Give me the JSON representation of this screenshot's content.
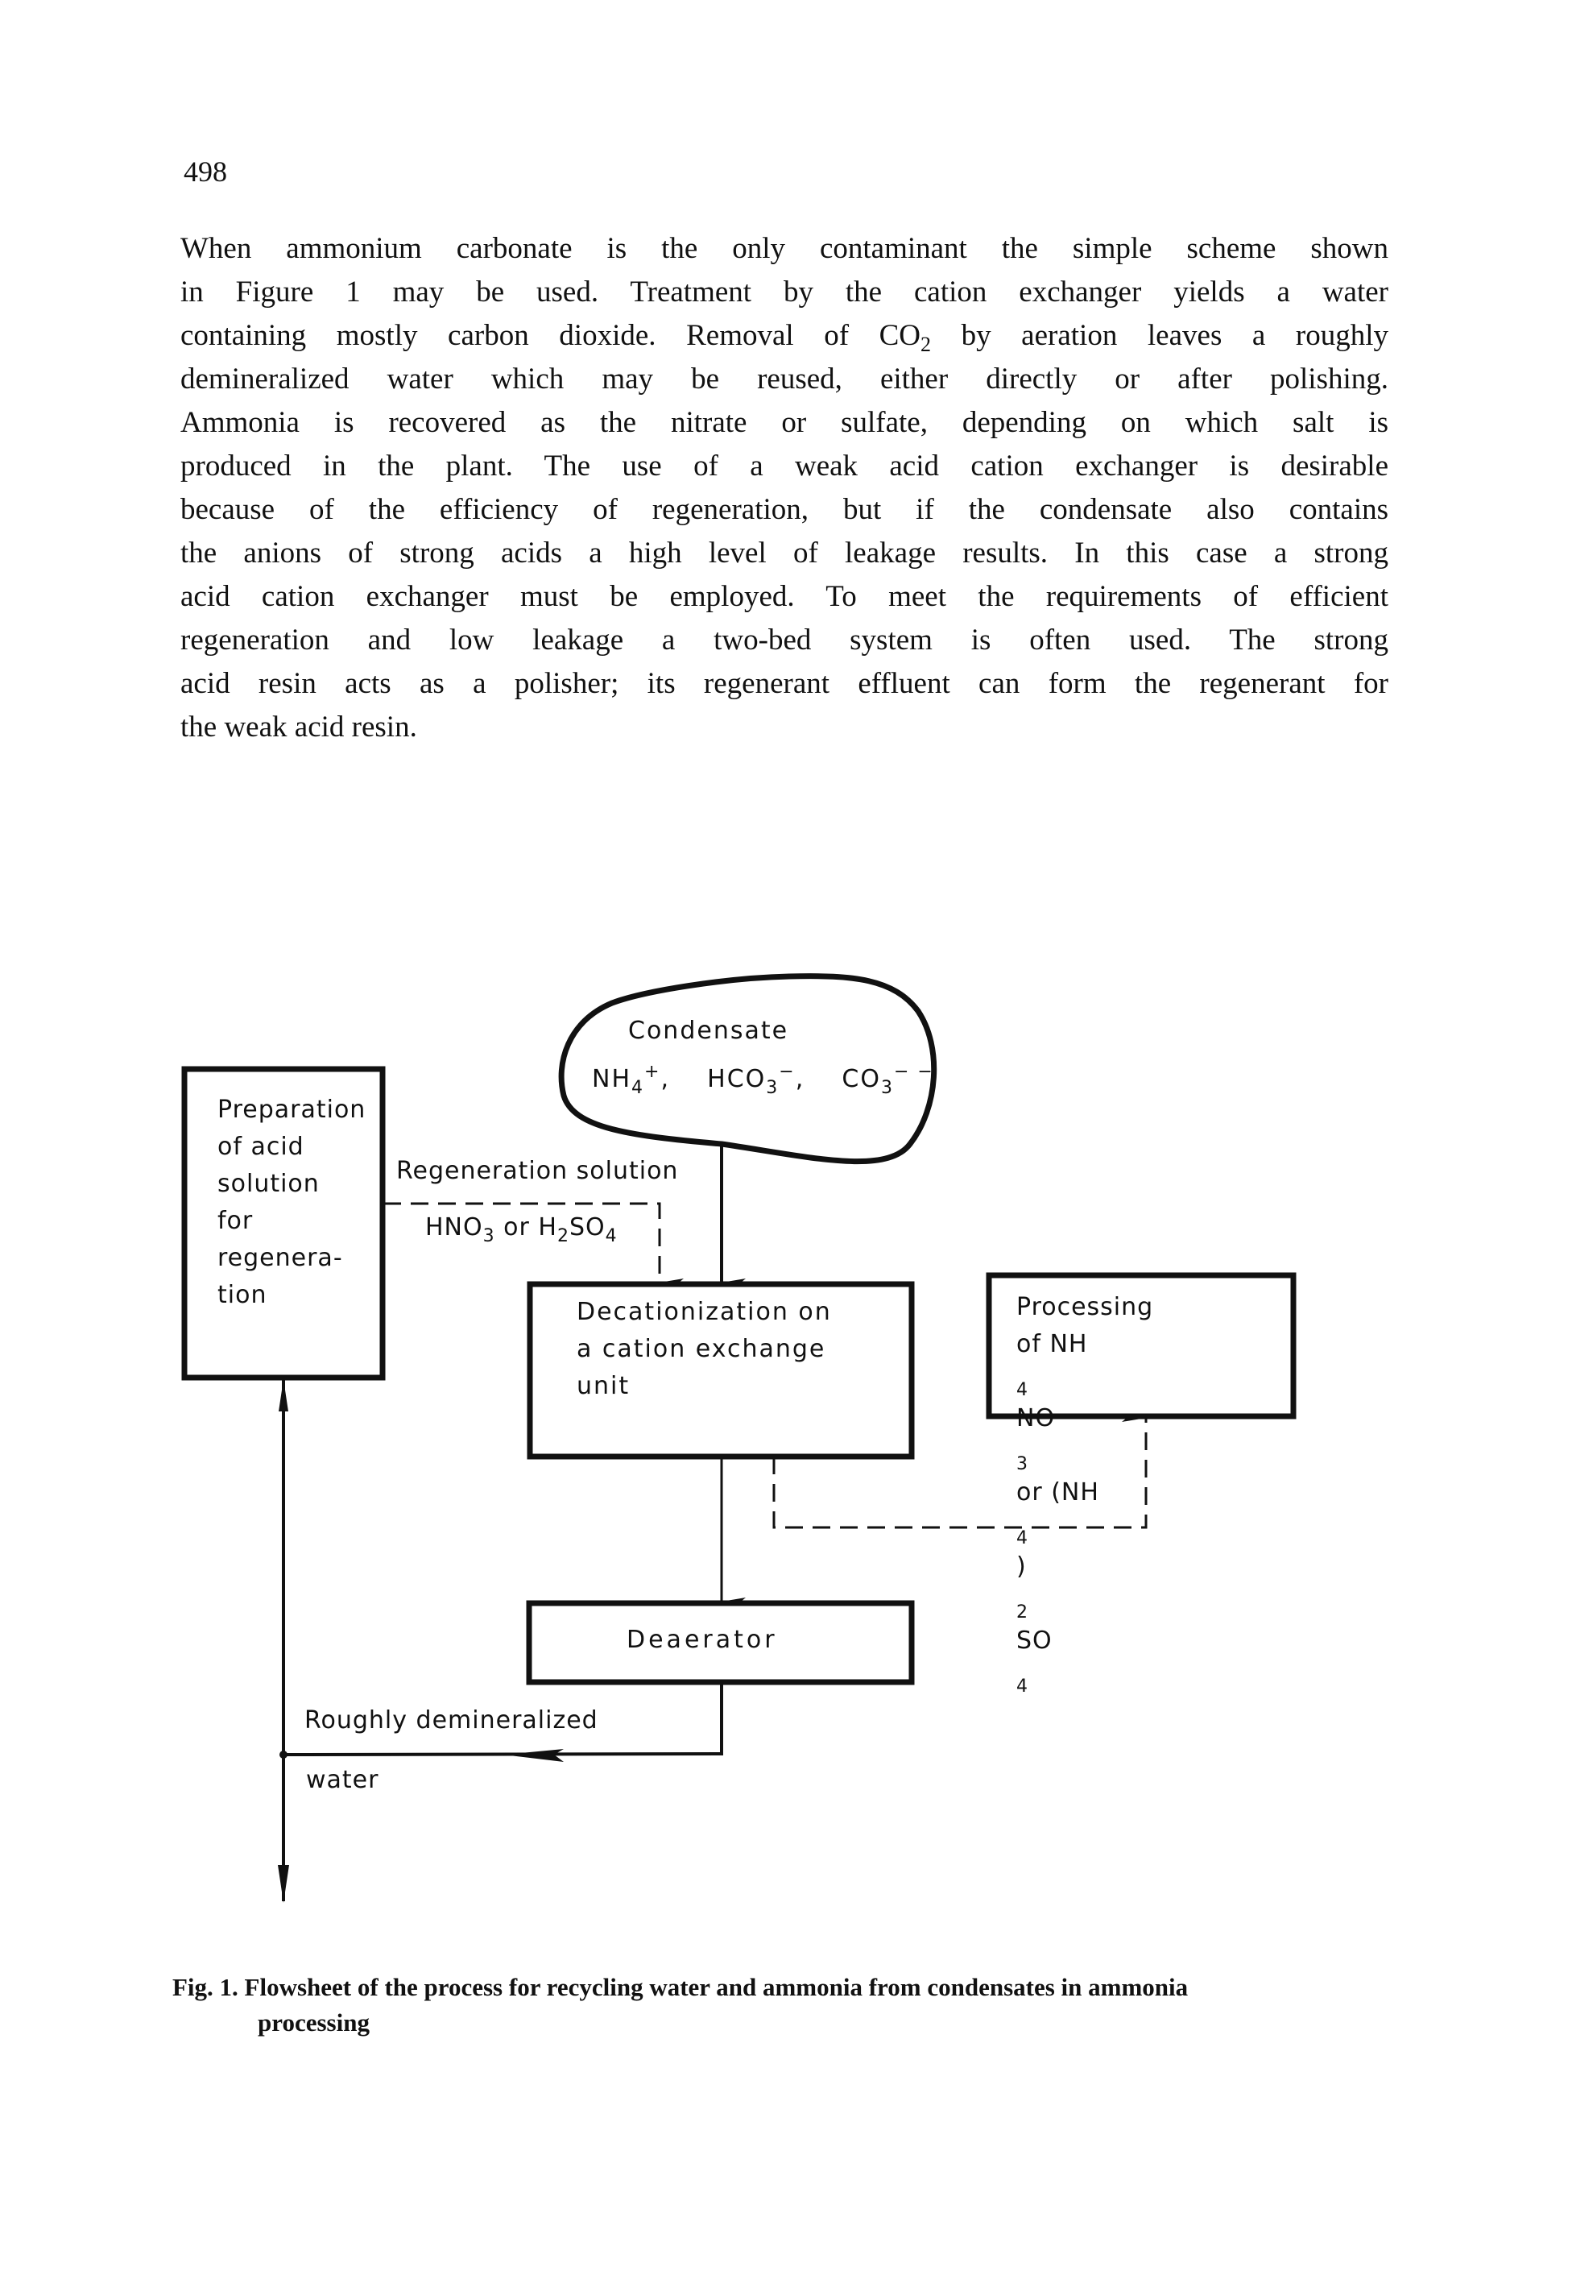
{
  "page": {
    "number": "498"
  },
  "body": {
    "lines": [
      "When ammonium carbonate is the only contaminant the simple scheme shown",
      "in Figure 1 may be used. Treatment by the cation exchanger yields a water",
      "containing mostly carbon dioxide. Removal of CO|2| by aeration leaves a roughly",
      "demineralized water which may be reused, either directly or after polishing.",
      "Ammonia is recovered as the nitrate or sulfate, depending on which salt is",
      "produced in the plant. The use of a weak acid cation exchanger is desirable",
      "because of the efficiency of regeneration, but if the condensate also contains",
      "the anions of strong acids a high level of leakage results. In this case a strong",
      "acid cation exchanger must be employed. To meet the requirements of efficient",
      "regeneration and low leakage a two-bed system is often used. The strong",
      "acid resin acts as a polisher; its regenerant effluent can form the regenerant for",
      "the weak acid resin."
    ],
    "line3_parts": {
      "before": "containing mostly carbon dioxide. Removal of CO",
      "sub": "2",
      "after": " by aeration leaves a roughly"
    }
  },
  "diagram": {
    "condensate": {
      "title": "Condensate",
      "ion1_base": "NH",
      "ion1_sub": "4",
      "ion1_sup": "+",
      "ion2_base": "HCO",
      "ion2_sub": "3",
      "ion2_sup": "−",
      "ion3_base": "CO",
      "ion3_sub": "3",
      "ion3_sup": "− −",
      "sep": ","
    },
    "prep_box": {
      "lines": [
        "Preparation",
        "of acid",
        "solution",
        "for",
        "regenera-",
        "tion"
      ]
    },
    "regeneration": {
      "label": "Regeneration solution",
      "acid1_base": "HNO",
      "acid1_sub": "3",
      "or": " or ",
      "acid2_h": "H",
      "acid2_h_sub": "2",
      "acid2_so": "SO",
      "acid2_so_sub": "4"
    },
    "decat_box": {
      "lines": [
        "Decationization on",
        "a cation exchange",
        "unit"
      ]
    },
    "processing_box": {
      "line1": "Processing",
      "line2_pre": "of NH",
      "line2_sub1": "4",
      "line2_mid": "NO",
      "line2_sub2": "3",
      "line3_pre": "or (NH",
      "line3_sub1": "4",
      "line3_mid": ")",
      "line3_sub2": "2",
      "line3_so": " SO",
      "line3_sub3": "4"
    },
    "deaerator_box": {
      "label": "Deaerator"
    },
    "output": {
      "label_line1": "Roughly demineralized",
      "label_line2": "water"
    }
  },
  "caption": {
    "line1": "Fig. 1. Flowsheet of the process for recycling water and ammonia from condensates in ammonia",
    "line2": "processing"
  }
}
